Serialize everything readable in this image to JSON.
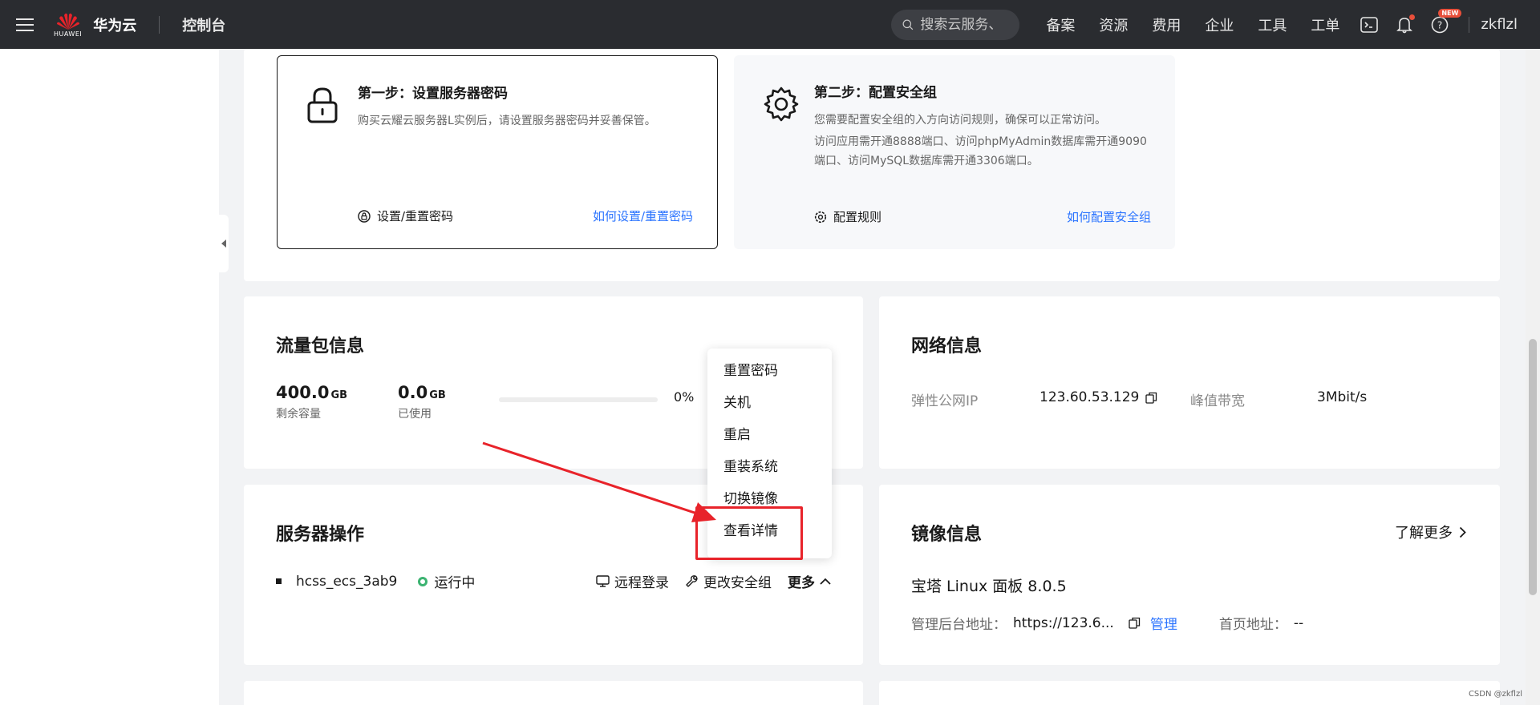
{
  "topbar": {
    "logo_small": "HUAWEI",
    "logo_name": "华为云",
    "console": "控制台",
    "search_placeholder": "搜索云服务、",
    "nav": [
      "备案",
      "资源",
      "费用",
      "企业",
      "工具",
      "工单"
    ],
    "new_badge": "NEW",
    "user": "zkflzl"
  },
  "steps": {
    "step1": {
      "title": "第一步：设置服务器密码",
      "desc": "购买云耀云服务器L实例后，请设置服务器密码并妥善保管。",
      "action": "设置/重置密码",
      "link": "如何设置/重置密码"
    },
    "step2": {
      "title": "第二步：配置安全组",
      "desc1": "您需要配置安全组的入方向访问规则，确保可以正常访问。",
      "desc2": "访问应用需开通8888端口、访问phpMyAdmin数据库需开通9090端口、访问MySQL数据库需开通3306端口。",
      "action": "配置规则",
      "link": "如何配置安全组"
    }
  },
  "traffic": {
    "title": "流量包信息",
    "remaining_value": "400.0",
    "remaining_unit": "GB",
    "remaining_label": "剩余容量",
    "used_value": "0.0",
    "used_unit": "GB",
    "used_label": "已使用",
    "used_percent": 0,
    "percent_text": "0%"
  },
  "network": {
    "title": "网络信息",
    "ip_label": "弹性公网IP",
    "ip_value": "123.60.53.129",
    "bw_label": "峰值带宽",
    "bw_value": "3Mbit/s"
  },
  "server": {
    "title": "服务器操作",
    "name": "hcss_ecs_3ab9",
    "status": "运行中",
    "status_color": "#3cb371",
    "op_remote": "远程登录",
    "op_security": "更改安全组",
    "op_more": "更多"
  },
  "dropdown": {
    "items": [
      "重置密码",
      "关机",
      "重启",
      "重装系统",
      "切换镜像",
      "查看详情"
    ]
  },
  "image": {
    "title": "镜像信息",
    "learn_more": "了解更多",
    "name": "宝塔 Linux 面板 8.0.5",
    "admin_label": "管理后台地址：",
    "admin_value": "https://123.6...",
    "manage": "管理",
    "home_label": "首页地址：",
    "home_value": "--"
  },
  "watermark": "CSDN @zkflzl",
  "colors": {
    "accent": "#2a73ff",
    "highlight": "#e8232a",
    "arrow": "#e8232a"
  }
}
